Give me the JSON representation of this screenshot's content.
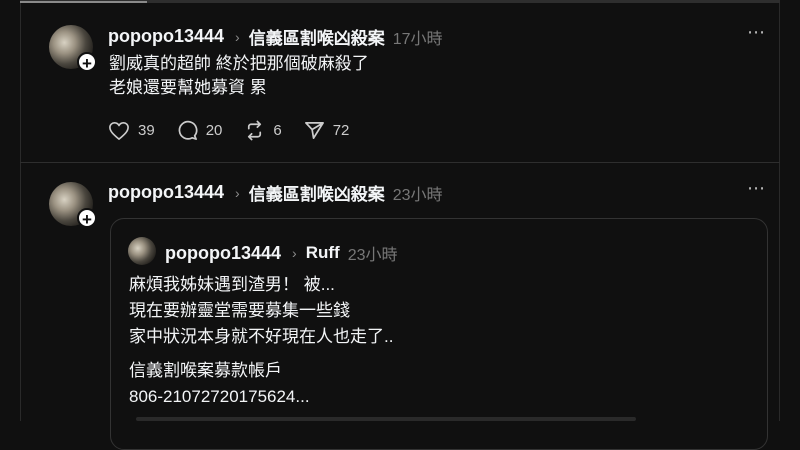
{
  "posts": [
    {
      "username": "popopo13444",
      "thread": "信義區割喉凶殺案",
      "time": "17小時",
      "lines": [
        "劉威真的超帥 終於把那個破麻殺了",
        "老娘還要幫她募資 累"
      ],
      "likes": "39",
      "replies": "20",
      "reposts": "6",
      "shares": "72"
    },
    {
      "username": "popopo13444",
      "thread": "信義區割喉凶殺案",
      "time": "23小時",
      "quote": {
        "username": "popopo13444",
        "thread": "Ruff",
        "time": "23小時",
        "lines": [
          "麻煩我姊妹遇到渣男！ 被...",
          "現在要辦靈堂需要募集一些錢",
          "家中狀況本身就不好現在人也走了.."
        ],
        "lines2": [
          "信義割喉案募款帳戶",
          "806-21072720175624..."
        ]
      }
    }
  ],
  "ui": {
    "more_icon": "⋯",
    "chevron_icon": "›",
    "plus_icon": "+"
  }
}
